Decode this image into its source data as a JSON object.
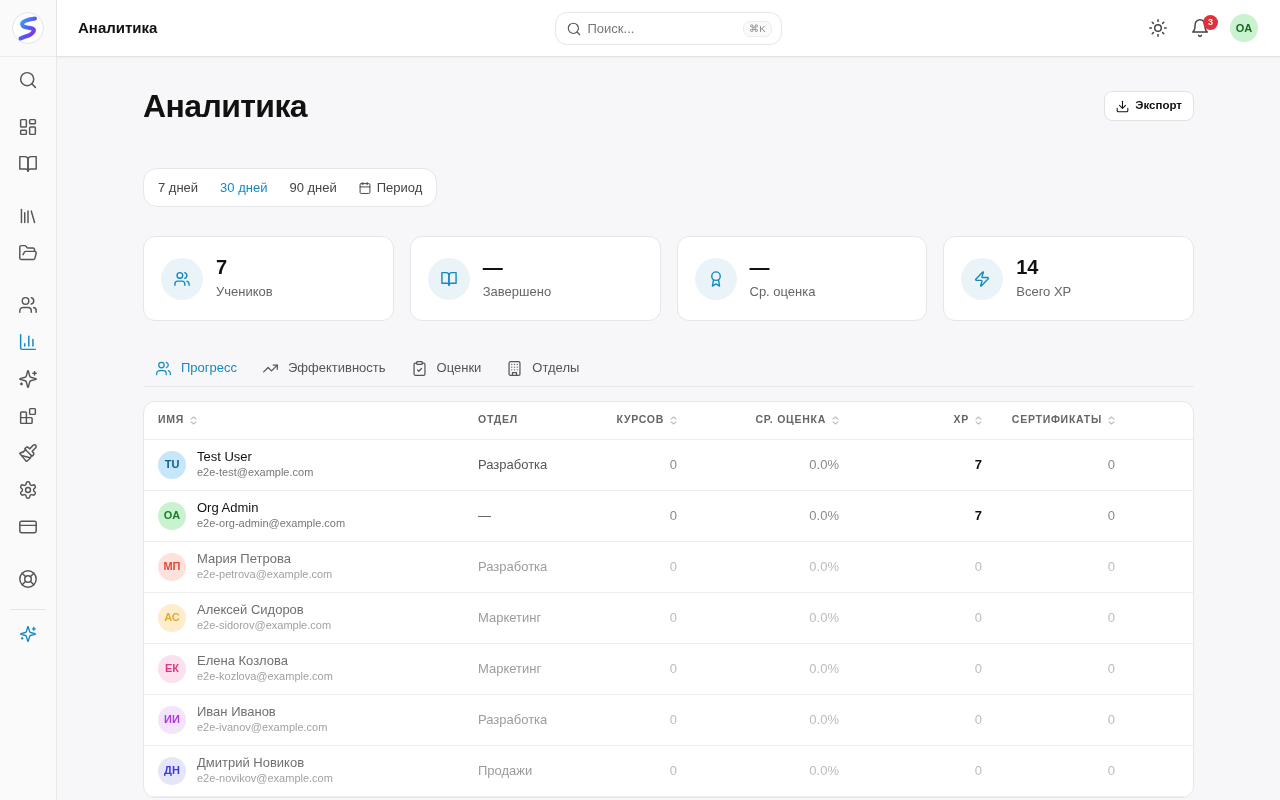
{
  "sidebar": {
    "groups": [
      [
        {
          "selected": false
        }
      ],
      [
        {
          "selected": false
        },
        {
          "selected": false
        }
      ],
      [
        {
          "selected": false
        },
        {
          "selected": false
        }
      ],
      [
        {
          "selected": false
        },
        {
          "selected": true
        },
        {
          "selected": false
        },
        {
          "selected": false
        },
        {
          "selected": false
        },
        {
          "selected": false
        },
        {
          "selected": false
        }
      ],
      [
        {
          "selected": false
        }
      ]
    ]
  },
  "topbar": {
    "title": "Аналитика",
    "search": {
      "placeholder": "Поиск...",
      "shortcut": "⌘K"
    },
    "notifications_badge": "3",
    "avatar": {
      "initials": "OA",
      "color": "#c9f2cf"
    }
  },
  "page": {
    "title": "Аналитика",
    "export_button": "Экспорт"
  },
  "periods": [
    {
      "label": "7 дней",
      "kind": "preset",
      "selected": false
    },
    {
      "label": "30 дней",
      "kind": "preset",
      "selected": true
    },
    {
      "label": "90 дней",
      "kind": "preset",
      "selected": false
    },
    {
      "label": "Период",
      "kind": "range",
      "selected": false
    }
  ],
  "stats": [
    {
      "value": "7",
      "label": "Учеников"
    },
    {
      "value": "—",
      "label": "Завершено"
    },
    {
      "value": "—",
      "label": "Ср. оценка"
    },
    {
      "value": "14",
      "label": "Всего XP"
    }
  ],
  "tabs": [
    {
      "label": "Прогресс",
      "selected": true
    },
    {
      "label": "Эффективность",
      "selected": false
    },
    {
      "label": "Оценки",
      "selected": false
    },
    {
      "label": "Отделы",
      "selected": false
    }
  ],
  "table": {
    "columns": [
      {
        "label": "ИМЯ",
        "sortable": true
      },
      {
        "label": "ОТДЕЛ",
        "sortable": false
      },
      {
        "label": "КУРСОВ",
        "sortable": true
      },
      {
        "label": "СР. ОЦЕНКА",
        "sortable": true
      },
      {
        "label": "XP",
        "sortable": true
      },
      {
        "label": "СЕРТИФИКАТЫ",
        "sortable": true
      }
    ],
    "rows": [
      {
        "initials": "TU",
        "color": "#c6e7fa",
        "name": "Test User",
        "email": "e2e-test@example.com",
        "department": "Разработка",
        "courses": "0",
        "score": "0.0%",
        "xp": "7",
        "certificates": "0",
        "active": true
      },
      {
        "initials": "OA",
        "color": "#c9f2cf",
        "name": "Org Admin",
        "email": "e2e-org-admin@example.com",
        "department": "—",
        "courses": "0",
        "score": "0.0%",
        "xp": "7",
        "certificates": "0",
        "active": true
      },
      {
        "initials": "МП",
        "color": "#fde1dd",
        "name": "Мария Петрова",
        "email": "e2e-petrova@example.com",
        "department": "Разработка",
        "courses": "0",
        "score": "0.0%",
        "xp": "0",
        "certificates": "0",
        "active": false
      },
      {
        "initials": "АС",
        "color": "#fdedcc",
        "name": "Алексей Сидоров",
        "email": "e2e-sidorov@example.com",
        "department": "Маркетинг",
        "courses": "0",
        "score": "0.0%",
        "xp": "0",
        "certificates": "0",
        "active": false
      },
      {
        "initials": "ЕК",
        "color": "#fbe1ed",
        "name": "Елена Козлова",
        "email": "e2e-kozlova@example.com",
        "department": "Маркетинг",
        "courses": "0",
        "score": "0.0%",
        "xp": "0",
        "certificates": "0",
        "active": false
      },
      {
        "initials": "ИИ",
        "color": "#f4e4fb",
        "name": "Иван Иванов",
        "email": "e2e-ivanov@example.com",
        "department": "Разработка",
        "courses": "0",
        "score": "0.0%",
        "xp": "0",
        "certificates": "0",
        "active": false
      },
      {
        "initials": "ДН",
        "color": "#e6e6fb",
        "name": "Дмитрий Новиков",
        "email": "e2e-novikov@example.com",
        "department": "Продажи",
        "courses": "0",
        "score": "0.0%",
        "xp": "0",
        "certificates": "0",
        "active": false
      }
    ]
  }
}
